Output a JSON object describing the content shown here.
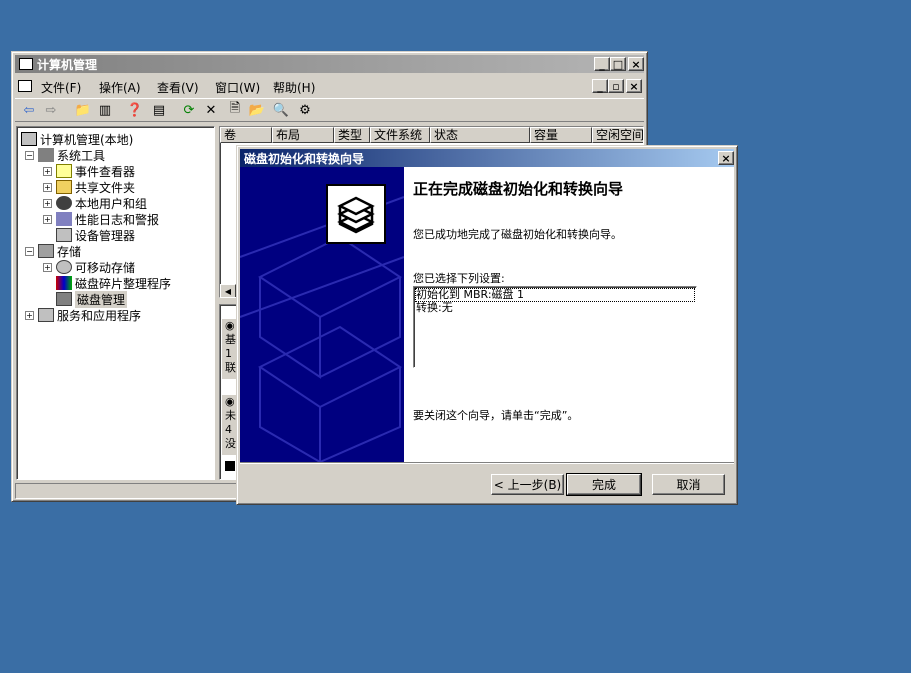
{
  "main_window": {
    "title": "计算机管理",
    "menus": [
      "文件(F)",
      "操作(A)",
      "查看(V)",
      "窗口(W)",
      "帮助(H)"
    ],
    "tree": {
      "root": "计算机管理(本地)",
      "system_tools": "系统工具",
      "event_viewer": "事件查看器",
      "shared_folders": "共享文件夹",
      "local_users": "本地用户和组",
      "perf_logs": "性能日志和警报",
      "device_manager": "设备管理器",
      "storage": "存储",
      "removable_storage": "可移动存储",
      "defrag": "磁盘碎片整理程序",
      "disk_management": "磁盘管理",
      "services_apps": "服务和应用程序"
    },
    "columns": [
      "卷",
      "布局",
      "类型",
      "文件系统",
      "状态",
      "容量",
      "空闲空间"
    ],
    "disk_panel_fragments": [
      "基",
      "1",
      "联",
      "未",
      "4",
      "没"
    ]
  },
  "wizard": {
    "title": "磁盘初始化和转换向导",
    "heading": "正在完成磁盘初始化和转换向导",
    "success_text": "您已成功地完成了磁盘初始化和转换向导。",
    "settings_label": "您已选择下列设置:",
    "settings": [
      "初始化到 MBR:磁盘 1",
      "转换:无"
    ],
    "close_text": "要关闭这个向导，请单击“完成”。",
    "buttons": {
      "back": "< 上一步(B)",
      "finish": "完成",
      "cancel": "取消"
    }
  }
}
